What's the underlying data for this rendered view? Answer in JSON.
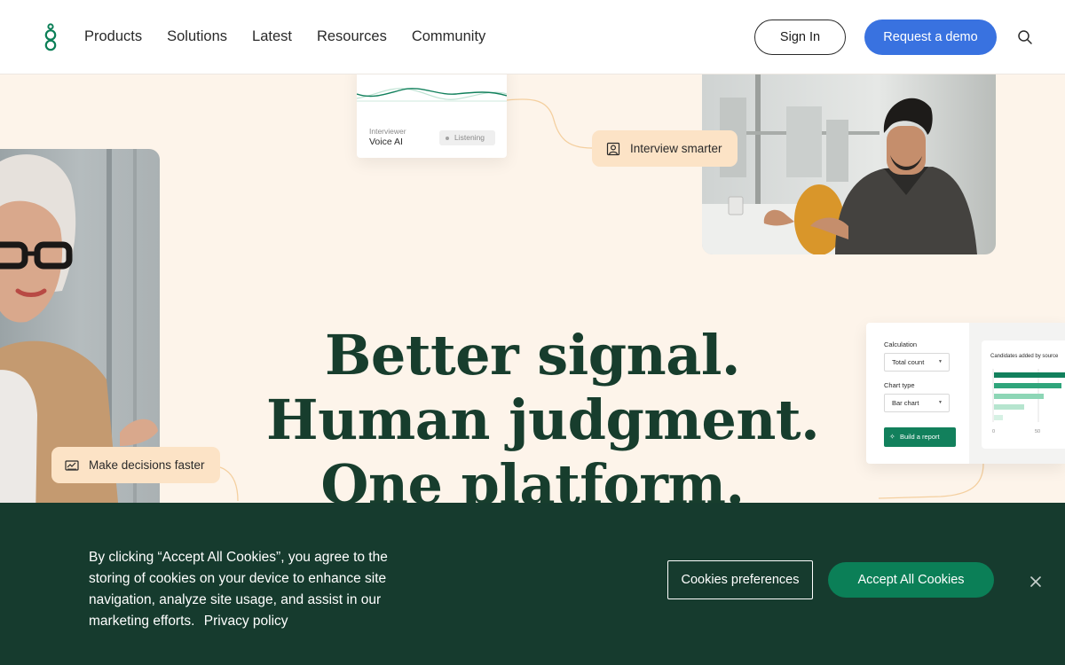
{
  "header": {
    "nav": [
      "Products",
      "Solutions",
      "Latest",
      "Resources",
      "Community"
    ],
    "sign_in": "Sign In",
    "request_demo": "Request a demo"
  },
  "hero": {
    "headline": [
      "Better signal.",
      "Human judgment.",
      "One platform."
    ],
    "voice_card": {
      "label": "Interviewer",
      "name": "Voice AI",
      "status": "Listening"
    },
    "pills": {
      "interview": "Interview smarter",
      "decisions": "Make decisions faster"
    },
    "report_card": {
      "calculation_label": "Calculation",
      "calculation_value": "Total count",
      "chart_type_label": "Chart type",
      "chart_type_value": "Bar chart",
      "build_button": "Build a report",
      "chart_title": "Candidates added by source",
      "axis_min": "0",
      "axis_max": "50"
    }
  },
  "cookie_banner": {
    "text": "By clicking “Accept All Cookies”, you agree to the storing of cookies on your device to enhance site navigation, analyze site usage, and assist in our marketing efforts.",
    "privacy_link": "Privacy policy",
    "preferences_button": "Cookies preferences",
    "accept_button": "Accept All Cookies"
  },
  "colors": {
    "brand_green": "#0b7f57",
    "dark_green": "#163b2e",
    "headline_green": "#173d2d",
    "accent_blue": "#3972e0",
    "pill_peach": "#fce3c6",
    "hero_bg": "#fdf4ea"
  },
  "icons": {
    "logo": "brand-logo-icon",
    "search": "search-icon",
    "interview": "interview-icon",
    "decisions": "chart-card-icon",
    "close": "close-icon"
  }
}
